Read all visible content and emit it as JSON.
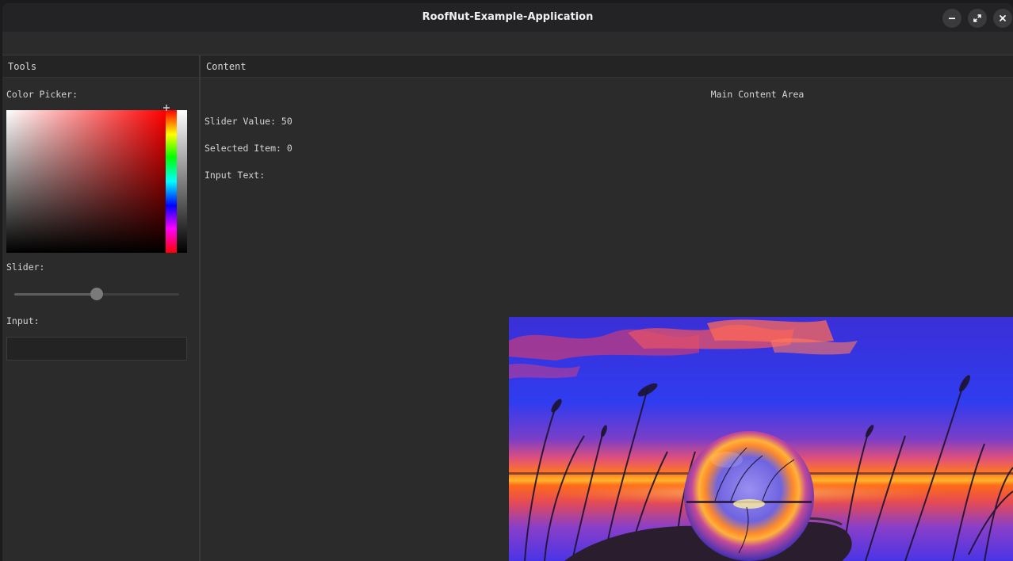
{
  "window": {
    "title": "RoofNut-Example-Application"
  },
  "window_controls": {
    "minimize": "window-minimize",
    "maximize": "window-maximize",
    "close": "window-close"
  },
  "tools_panel": {
    "header": "Tools",
    "color_picker_label": "Color Picker:",
    "selected_color": "#ff0000",
    "slider_label": "Slider:",
    "slider_value": 50,
    "slider_min": 0,
    "slider_max": 100,
    "input_label": "Input:",
    "input_value": "",
    "input_placeholder": ""
  },
  "content_panel": {
    "header": "Content",
    "title": "Main Content Area",
    "slider_value_text": "Slider Value: 50",
    "selected_item_text": "Selected Item: 0",
    "input_text_text": "Input Text:"
  },
  "colors": {
    "accent": "#ff0000",
    "panel_bg": "#2b2b2b",
    "titlebar_bg": "#232325"
  }
}
